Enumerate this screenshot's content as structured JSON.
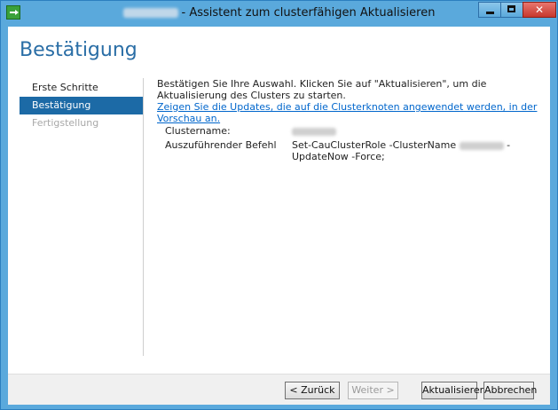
{
  "window": {
    "title": "- Assistent zum clusterfähigen Aktualisieren"
  },
  "page": {
    "title": "Bestätigung"
  },
  "nav": {
    "items": [
      {
        "label": "Erste Schritte"
      },
      {
        "label": "Bestätigung"
      },
      {
        "label": "Fertigstellung"
      }
    ]
  },
  "content": {
    "intro": "Bestätigen Sie Ihre Auswahl. Klicken Sie auf \"Aktualisieren\", um die Aktualisierung des Clusters zu starten.",
    "preview_link": "Zeigen Sie die Updates, die auf die Clusterknoten angewendet werden, in der Vorschau an.",
    "details": {
      "cluster_label": "Clustername:",
      "command_label": "Auszuführender Befehl",
      "command_part1": "Set-CauClusterRole -ClusterName",
      "command_part2": "-UpdateNow -Force;"
    }
  },
  "footer": {
    "back": "< Zurück",
    "next": "Weiter >",
    "update": "Aktualisieren",
    "cancel": "Abbrechen"
  }
}
